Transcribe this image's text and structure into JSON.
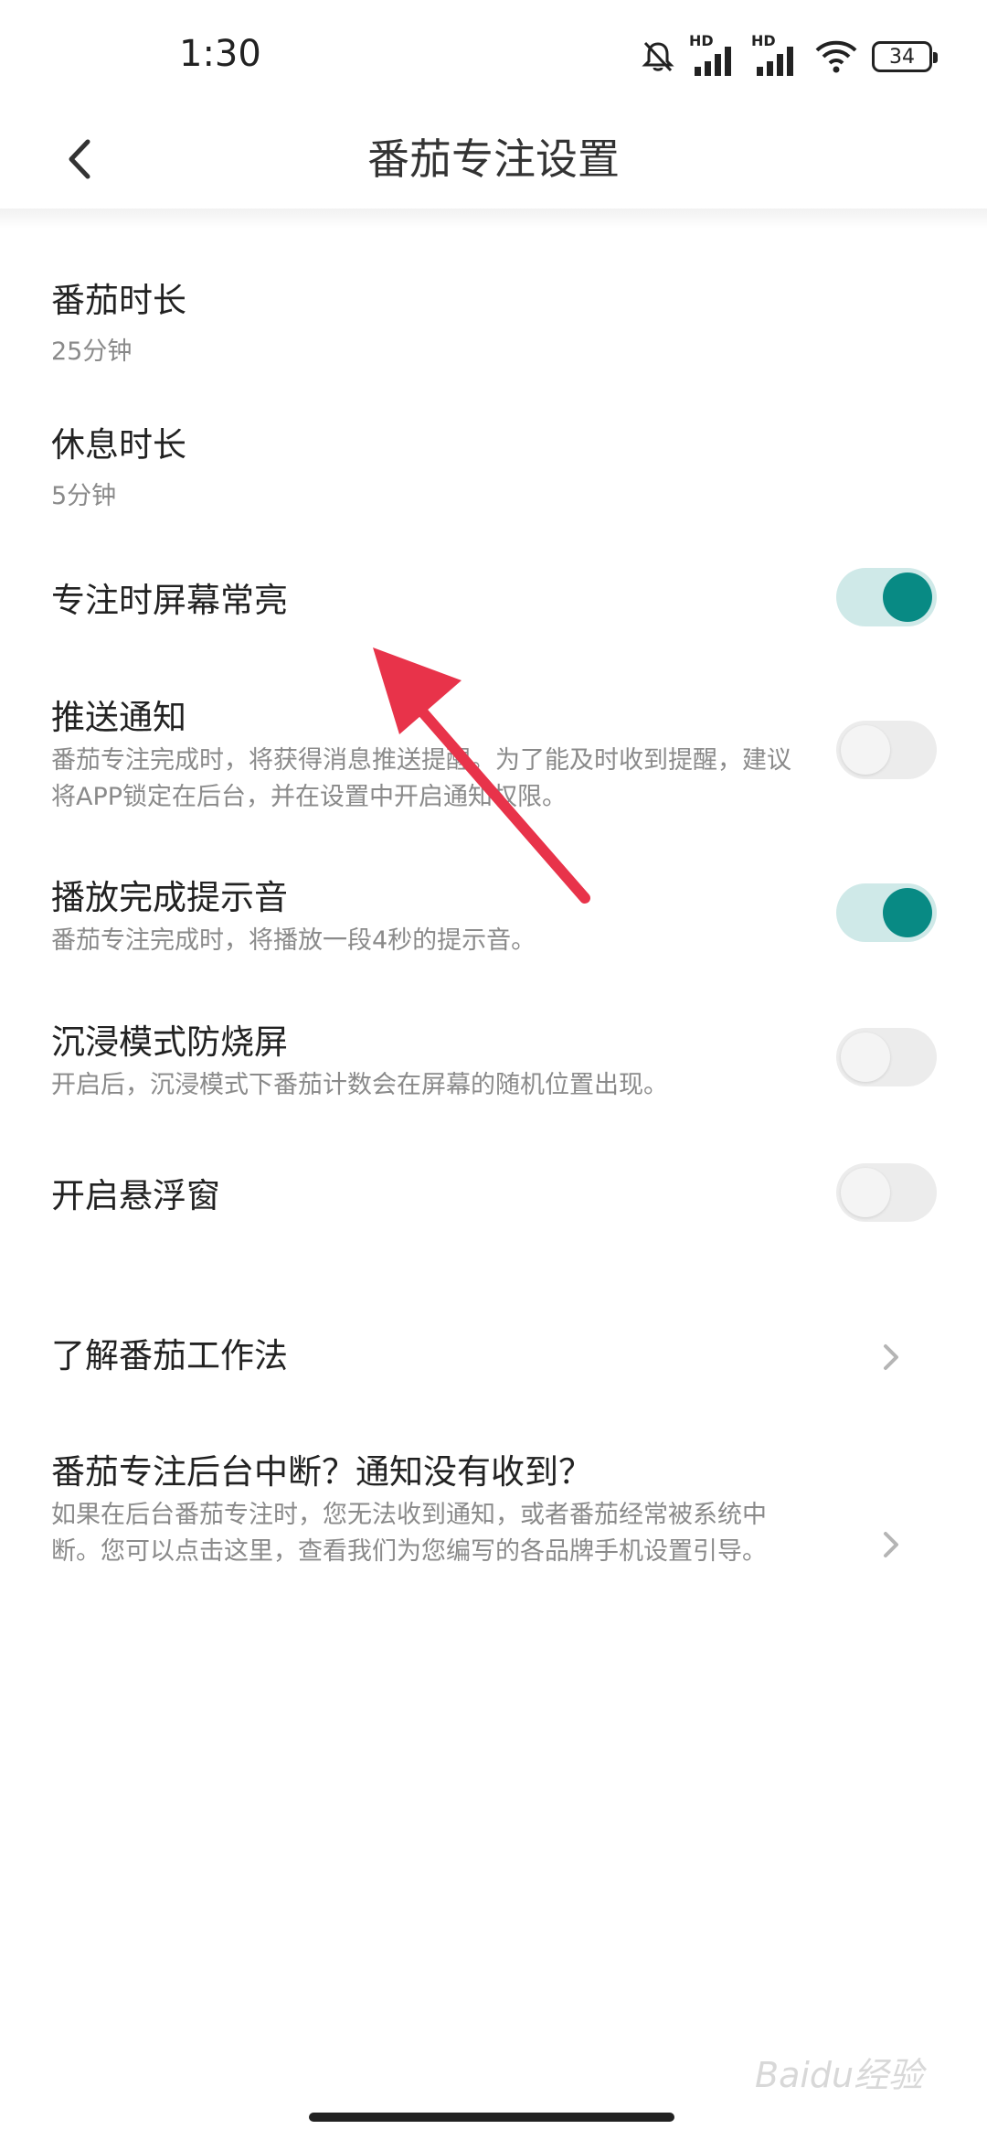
{
  "status_bar": {
    "time": "1:30",
    "battery": "34",
    "network_label_1": "HD",
    "network_label_2": "HD"
  },
  "header": {
    "title": "番茄专注设置"
  },
  "settings": {
    "pomodoro_duration": {
      "label": "番茄时长",
      "value": "25分钟"
    },
    "break_duration": {
      "label": "休息时长",
      "value": "5分钟"
    },
    "keep_screen_on": {
      "label": "专注时屏幕常亮",
      "enabled": true
    },
    "push_notification": {
      "label": "推送通知",
      "description": "番茄专注完成时，将获得消息推送提醒。为了能及时收到提醒，建议将APP锁定在后台，并在设置中开启通知权限。",
      "enabled": false
    },
    "completion_sound": {
      "label": "播放完成提示音",
      "description": "番茄专注完成时，将播放一段4秒的提示音。",
      "enabled": true
    },
    "burn_in_protection": {
      "label": "沉浸模式防烧屏",
      "description": "开启后，沉浸模式下番茄计数会在屏幕的随机位置出现。",
      "enabled": false
    },
    "floating_window": {
      "label": "开启悬浮窗",
      "enabled": false
    },
    "learn_pomodoro": {
      "label": "了解番茄工作法"
    },
    "background_interrupt": {
      "label": "番茄专注后台中断？通知没有收到？",
      "description": "如果在后台番茄专注时，您无法收到通知，或者番茄经常被系统中断。您可以点击这里，查看我们为您编写的各品牌手机设置引导。"
    }
  },
  "watermark": "Baidu经验",
  "colors": {
    "accent": "#088a84",
    "toggle_on_track": "#cfe9e8",
    "toggle_off_track": "#ececec",
    "annotation_arrow": "#e8334a"
  }
}
